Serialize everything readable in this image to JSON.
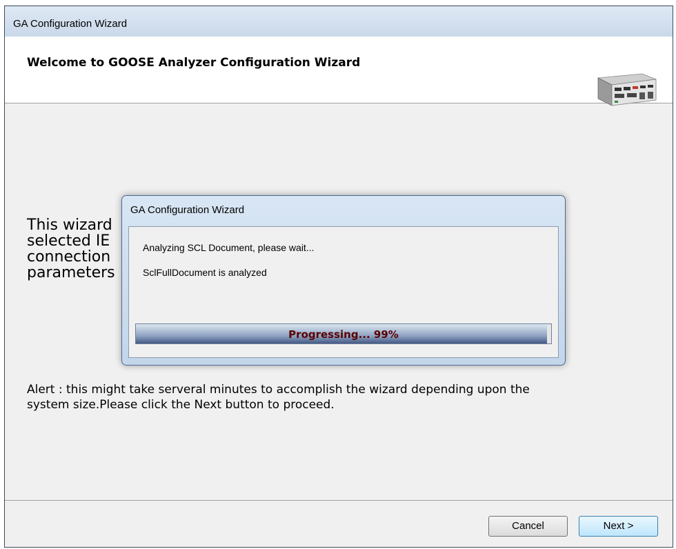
{
  "window": {
    "title": "GA Configuration Wizard",
    "header_title": "Welcome to GOOSE Analyzer Configuration Wizard"
  },
  "body": {
    "intro_line1": "This wizard                                                              the",
    "intro_line2": "selected IE                                                             OOSE",
    "intro_line3": "connection                                                               he",
    "intro_line4": "parameters",
    "alert_line1": "Alert : this might take serveral minutes to accomplish the wizard depending upon the",
    "alert_line2": "system size.Please click the Next button to proceed."
  },
  "buttons": {
    "cancel": "Cancel",
    "next": "Next >"
  },
  "dialog": {
    "title": "GA Configuration Wizard",
    "message1": "Analyzing SCL Document, please wait...",
    "message2": "SclFullDocument is analyzed",
    "progress_text": "Progressing... 99%",
    "progress_value": 99
  },
  "colors": {
    "titlebar": "#d4e2f1",
    "progress_fill_dark": "#445a85",
    "progress_text": "#5a0000",
    "next_button_border": "#3c7fb1"
  },
  "icons": {
    "header_image": "device-icon"
  }
}
